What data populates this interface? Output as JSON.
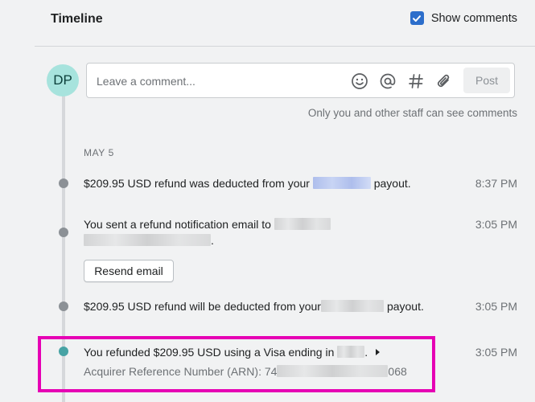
{
  "header": {
    "title": "Timeline",
    "show_comments_label": "Show comments",
    "show_comments_checked": true
  },
  "comment": {
    "avatar_initials": "DP",
    "placeholder": "Leave a comment...",
    "post_label": "Post",
    "tools": [
      "emoji-icon",
      "mention-icon",
      "hashtag-icon",
      "attachment-icon"
    ],
    "note": "Only you and other staff can see comments"
  },
  "timeline": {
    "date_label": "MAY 5",
    "events": [
      {
        "text_before": "$209.95 USD refund was deducted from your",
        "text_after": "payout.",
        "time": "8:37 PM"
      },
      {
        "text_before": "You sent a refund notification email to",
        "text_after": ".",
        "time": "3:05 PM",
        "action_label": "Resend email"
      },
      {
        "text_before": "$209.95 USD refund will be deducted from your",
        "text_after": "payout.",
        "time": "3:05 PM"
      },
      {
        "text_before": "You refunded $209.95 USD using a Visa ending in",
        "text_after": ".",
        "time": "3:05 PM",
        "detail_before": "Acquirer Reference Number (ARN): 74",
        "detail_after": "068"
      }
    ]
  },
  "colors": {
    "accent": "#2c6ecb",
    "highlight": "#e600b4",
    "avatar_bg": "#a7e3dd",
    "dot_active": "#47a3a4"
  }
}
